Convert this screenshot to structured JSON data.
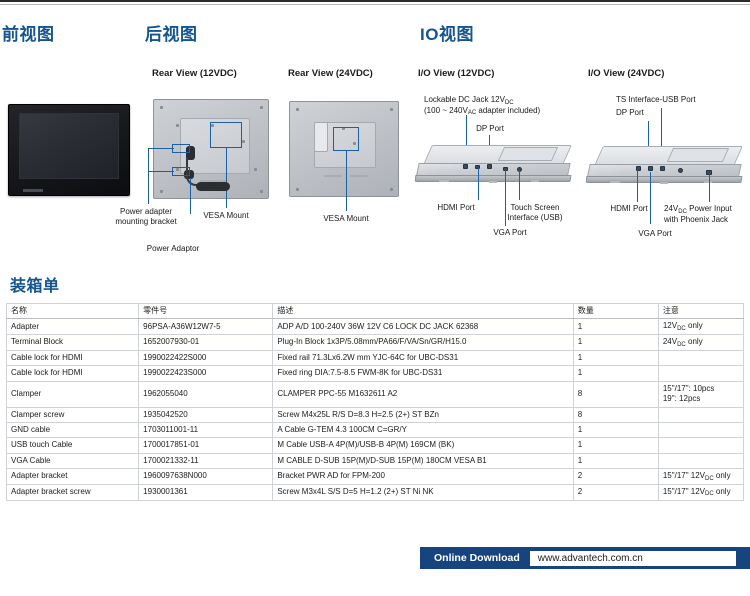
{
  "headings": {
    "front_view": "前视图",
    "rear_view": "后视图",
    "io_view": "IO视图",
    "packing_list": "装箱单"
  },
  "captions": {
    "rear_12vdc": "Rear View (12VDC)",
    "rear_24vdc": "Rear View (24VDC)",
    "io_12vdc": "I/O View (12VDC)",
    "io_24vdc": "I/O View (24VDC)"
  },
  "callouts": {
    "power_adapter_bracket": "Power adapter\nmounting bracket",
    "power_adaptor": "Power Adaptor",
    "vesa_mount_12": "VESA Mount",
    "vesa_mount_24": "VESA Mount",
    "lockable_dc_jack_line1": "Lockable DC Jack 12V",
    "lockable_dc_jack_sub": "DC",
    "lockable_dc_jack_line2_a": "(100 ~ 240V",
    "lockable_dc_jack_line2_sub": "AC",
    "lockable_dc_jack_line2_b": " adapter included)",
    "dp_port_12": "DP Port",
    "hdmi_port_12": "HDMI Port",
    "touch_screen_usb": "Touch Screen\nInterface (USB)",
    "vga_port_12": "VGA Port",
    "ts_interface_usb": "TS Interface-USB Port",
    "dp_port_24": "DP Port",
    "hdmi_port_24": "HDMI Port",
    "power_input_24_a": "24V",
    "power_input_24_sub": "DC",
    "power_input_24_b": " Power Input",
    "power_input_24_line2": "with Phoenix Jack",
    "vga_port_24": "VGA Port"
  },
  "table": {
    "columns": [
      "名称",
      "零件号",
      "描述",
      "数量",
      "注意"
    ],
    "rows": [
      {
        "name": "Adapter",
        "part_number": "96PSA-A36W12W7-5",
        "description": "ADP A/D 100-240V 36W 12V C6 LOCK DC JACK 62368",
        "qty": "1",
        "note_prefix": "12V",
        "note_sub": "DC",
        "note_suffix": " only"
      },
      {
        "name": "Terminal Block",
        "part_number": "1652007930-01",
        "description": "Plug-In Block 1x3P/5.08mm/PA66/F/VA/Sn/GR/H15.0",
        "qty": "1",
        "note_prefix": "24V",
        "note_sub": "DC",
        "note_suffix": " only"
      },
      {
        "name": "Cable lock for HDMI",
        "part_number": "1990022422S000",
        "description": "Fixed rail 71.3Lx6.2W mm YJC-64C for UBC-DS31",
        "qty": "1",
        "note_prefix": "",
        "note_sub": "",
        "note_suffix": ""
      },
      {
        "name": "Cable lock for HDMI",
        "part_number": "1990022423S000",
        "description": "Fixed ring DIA:7.5-8.5 FWM-8K for UBC-DS31",
        "qty": "1",
        "note_prefix": "",
        "note_sub": "",
        "note_suffix": ""
      },
      {
        "name": "Clamper",
        "part_number": "1962055040",
        "description": "CLAMPER PPC-55 M1632611 A2",
        "qty": "8",
        "note_prefix": "15\"/17\": 10pcs\n19\": 12pcs",
        "note_sub": "",
        "note_suffix": ""
      },
      {
        "name": "Clamper screw",
        "part_number": "1935042520",
        "description": "Screw M4x25L R/S D=8.3 H=2.5 (2+) ST BZn",
        "qty": "8",
        "note_prefix": "",
        "note_sub": "",
        "note_suffix": ""
      },
      {
        "name": "GND cable",
        "part_number": "1703011001-11",
        "description": "A Cable G-TEM 4.3 100CM C=GR/Y",
        "qty": "1",
        "note_prefix": "",
        "note_sub": "",
        "note_suffix": ""
      },
      {
        "name": "USB touch Cable",
        "part_number": "1700017851-01",
        "description": "M Cable USB-A 4P(M)/USB-B 4P(M) 169CM (BK)",
        "qty": "1",
        "note_prefix": "",
        "note_sub": "",
        "note_suffix": ""
      },
      {
        "name": "VGA Cable",
        "part_number": "1700021332-11",
        "description": "M CABLE D-SUB 15P(M)/D-SUB 15P(M) 180CM VESA B1",
        "qty": "1",
        "note_prefix": "",
        "note_sub": "",
        "note_suffix": ""
      },
      {
        "name": "Adapter bracket",
        "part_number": "1960097638N000",
        "description": "Bracket PWR AD for FPM-200",
        "qty": "2",
        "note_prefix": "15\"/17\" 12V",
        "note_sub": "DC",
        "note_suffix": " only"
      },
      {
        "name": "Adapter bracket screw",
        "part_number": "1930001361",
        "description": "Screw M3x4L S/S D=5 H=1.2 (2+) ST Ni NK",
        "qty": "2",
        "note_prefix": "15\"/17\" 12V",
        "note_sub": "DC",
        "note_suffix": " only"
      }
    ]
  },
  "footer": {
    "label": "Online Download",
    "url": "www.advantech.com.cn"
  },
  "colors": {
    "accent_blue": "#15558f",
    "footer_blue": "#16447f",
    "leader_blue": "#1d5fa4"
  }
}
